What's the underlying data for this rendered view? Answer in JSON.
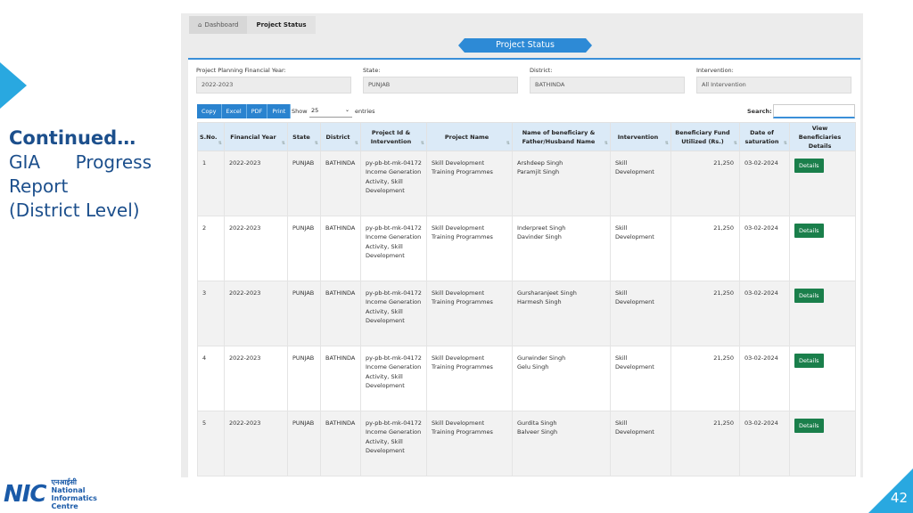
{
  "slide": {
    "title_line1": "Continued…",
    "title_line2": "GIA Progress",
    "title_line3": "Report",
    "title_line4": "(District Level)",
    "page_number": "42",
    "logo_mark": "NIC",
    "logo_text_hindi": "एनआईसी",
    "logo_text_line1": "National",
    "logo_text_line2": "Informatics",
    "logo_text_line3": "Centre",
    "accent_color": "#29a8e0"
  },
  "breadcrumb": {
    "home_icon": "home-icon",
    "items": [
      "Dashboard",
      "Project Status"
    ]
  },
  "page_title": "Project Status",
  "filters": {
    "year": {
      "label": "Project Planning Financial Year:",
      "value": "2022-2023"
    },
    "state": {
      "label": "State:",
      "value": "PUNJAB"
    },
    "district": {
      "label": "District:",
      "value": "BATHINDA"
    },
    "intervention": {
      "label": "Intervention:",
      "value": "All Intervention"
    }
  },
  "toolbar": {
    "copy": "Copy",
    "excel": "Excel",
    "pdf": "PDF",
    "print": "Print"
  },
  "length": {
    "show_label": "Show",
    "value": "25",
    "entries_label": "entries"
  },
  "search": {
    "label": "Search:",
    "value": ""
  },
  "table": {
    "headers": [
      "S.No.",
      "Financial Year",
      "State",
      "District",
      "Project Id & Intervention",
      "Project Name",
      "Name of beneficiary & Father/Husband Name",
      "Intervention",
      "Beneficiary Fund Utilized (Rs.)",
      "Date of saturation",
      "View Beneficiaries Details"
    ],
    "rows": [
      {
        "sno": "1",
        "year": "2022-2023",
        "state": "PUNJAB",
        "district": "BATHINDA",
        "project_id": "py-pb-bt-mk-04172 Income Generation Activity, Skill Development",
        "project_name": "Skill Development Training Programmes",
        "beneficiary": "Arshdeep Singh",
        "father": "Paramjit Singh",
        "intervention": "Skill Development",
        "fund": "21,250",
        "date": "03-02-2024",
        "action": "Details"
      },
      {
        "sno": "2",
        "year": "2022-2023",
        "state": "PUNJAB",
        "district": "BATHINDA",
        "project_id": "py-pb-bt-mk-04172 Income Generation Activity, Skill Development",
        "project_name": "Skill Development Training Programmes",
        "beneficiary": "Inderpreet Singh",
        "father": "Davinder Singh",
        "intervention": "Skill Development",
        "fund": "21,250",
        "date": "03-02-2024",
        "action": "Details"
      },
      {
        "sno": "3",
        "year": "2022-2023",
        "state": "PUNJAB",
        "district": "BATHINDA",
        "project_id": "py-pb-bt-mk-04172 Income Generation Activity, Skill Development",
        "project_name": "Skill Development Training Programmes",
        "beneficiary": "Gursharanjeet Singh",
        "father": "Harmesh Singh",
        "intervention": "Skill Development",
        "fund": "21,250",
        "date": "03-02-2024",
        "action": "Details"
      },
      {
        "sno": "4",
        "year": "2022-2023",
        "state": "PUNJAB",
        "district": "BATHINDA",
        "project_id": "py-pb-bt-mk-04172 Income Generation Activity, Skill Development",
        "project_name": "Skill Development Training Programmes",
        "beneficiary": "Gurwinder Singh",
        "father": "Gelu Singh",
        "intervention": "Skill Development",
        "fund": "21,250",
        "date": "03-02-2024",
        "action": "Details"
      },
      {
        "sno": "5",
        "year": "2022-2023",
        "state": "PUNJAB",
        "district": "BATHINDA",
        "project_id": "py-pb-bt-mk-04172 Income Generation Activity, Skill Development",
        "project_name": "Skill Development Training Programmes",
        "beneficiary": "Gurdita Singh",
        "father": "Balveer Singh",
        "intervention": "Skill Development",
        "fund": "21,250",
        "date": "03-02-2024",
        "action": "Details"
      }
    ]
  },
  "colors": {
    "primary": "#2a83cf",
    "details_button": "#1a7f4b",
    "header_bg": "#dbeaf7"
  }
}
